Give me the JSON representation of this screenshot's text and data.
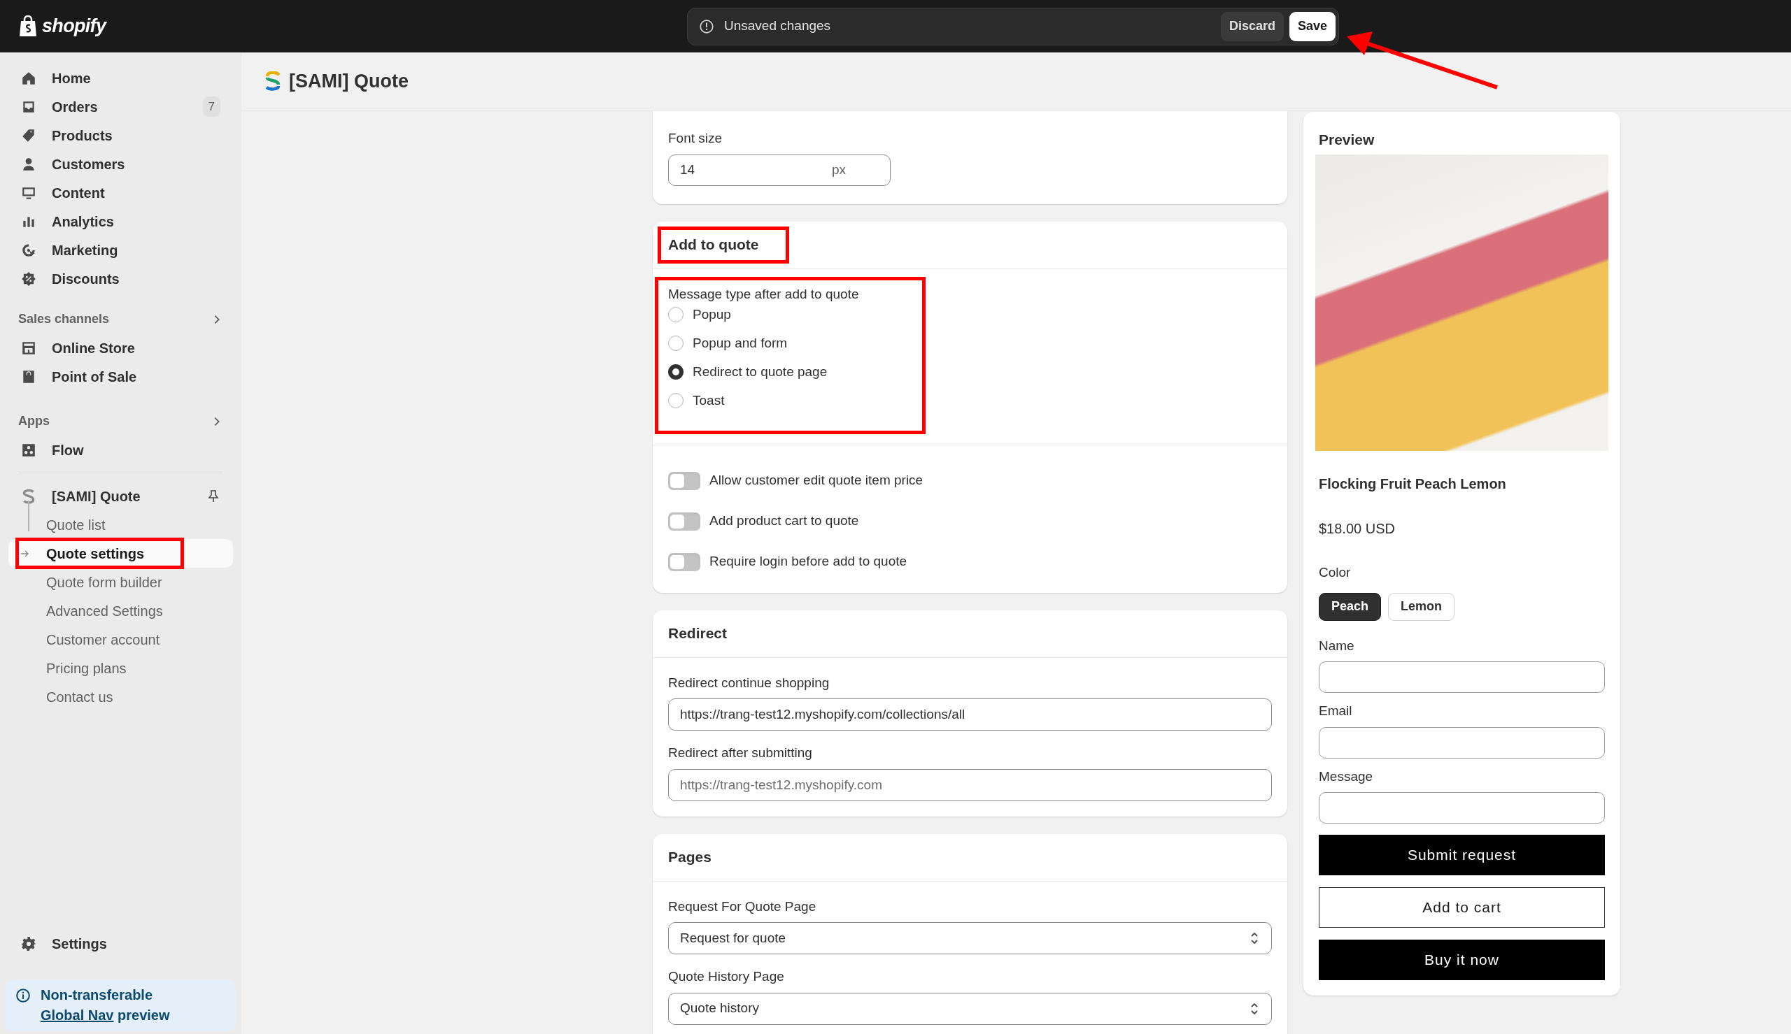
{
  "topbar": {
    "brand": "shopify",
    "notice": "Unsaved changes",
    "buttons": [
      {
        "label": "Discard",
        "kind": "secondary"
      },
      {
        "label": "Save",
        "kind": "primary"
      }
    ],
    "save_arrow": true
  },
  "sidebar": {
    "nav": [
      {
        "label": "Home"
      },
      {
        "label": "Orders",
        "badge": "7"
      },
      {
        "label": "Products"
      },
      {
        "label": "Customers"
      },
      {
        "label": "Content"
      },
      {
        "label": "Analytics"
      },
      {
        "label": "Marketing"
      },
      {
        "label": "Discounts"
      }
    ],
    "sections": [
      {
        "title": "Sales channels",
        "items": [
          {
            "label": "Online Store"
          },
          {
            "label": "Point of Sale"
          }
        ]
      },
      {
        "title": "Apps",
        "items": [
          {
            "label": "Flow"
          }
        ]
      }
    ],
    "app": {
      "label": "[SAMI] Quote",
      "children": [
        {
          "label": "Quote list",
          "selected": false,
          "highlighted": false
        },
        {
          "label": "Quote settings",
          "selected": true,
          "highlighted": true
        },
        {
          "label": "Quote form builder",
          "selected": false,
          "highlighted": false
        },
        {
          "label": "Advanced Settings",
          "selected": false,
          "highlighted": false
        },
        {
          "label": "Customer account",
          "selected": false,
          "highlighted": false
        },
        {
          "label": "Pricing plans",
          "selected": false,
          "highlighted": false
        },
        {
          "label": "Contact us",
          "selected": false,
          "highlighted": false
        }
      ]
    },
    "settings": "Settings",
    "banner": {
      "text": "Non-transferable",
      "link": "Global Nav",
      "suffix": "preview"
    }
  },
  "page": {
    "title": "[SAMI] Quote"
  },
  "font_size": {
    "label": "Font size",
    "value": "14",
    "suffix": "px"
  },
  "add_to_quote": {
    "title": "Add to quote",
    "highlighted": true,
    "message_type": {
      "label": "Message type after add to quote",
      "highlighted": true,
      "options": [
        {
          "label": "Popup",
          "selected": false
        },
        {
          "label": "Popup and form",
          "selected": false
        },
        {
          "label": "Redirect to quote page",
          "selected": true
        },
        {
          "label": "Toast",
          "selected": false
        }
      ]
    },
    "toggles": [
      {
        "label": "Allow customer edit quote item price",
        "on": false
      },
      {
        "label": "Add product cart to quote",
        "on": false
      },
      {
        "label": "Require login before add to quote",
        "on": false
      }
    ]
  },
  "redirect": {
    "title": "Redirect",
    "fields": [
      {
        "label": "Redirect continue shopping",
        "value": "https://trang-test12.myshopify.com/collections/all"
      },
      {
        "label": "Redirect after submitting",
        "placeholder": "https://trang-test12.myshopify.com"
      }
    ]
  },
  "pages": {
    "title": "Pages",
    "selects": [
      {
        "label": "Request For Quote Page",
        "value": "Request for quote"
      },
      {
        "label": "Quote History Page",
        "value": "Quote history"
      }
    ]
  },
  "preview": {
    "title": "Preview",
    "product": {
      "name": "Flocking Fruit Peach Lemon",
      "price": "$18.00 USD"
    },
    "color": {
      "label": "Color",
      "options": [
        {
          "label": "Peach",
          "selected": true
        },
        {
          "label": "Lemon",
          "selected": false
        }
      ]
    },
    "fields": [
      {
        "label": "Name"
      },
      {
        "label": "Email"
      },
      {
        "label": "Message"
      }
    ],
    "buttons": [
      {
        "label": "Submit request",
        "kind": "solid"
      },
      {
        "label": "Add to cart",
        "kind": "outline"
      },
      {
        "label": "Buy it now",
        "kind": "solid"
      }
    ]
  }
}
